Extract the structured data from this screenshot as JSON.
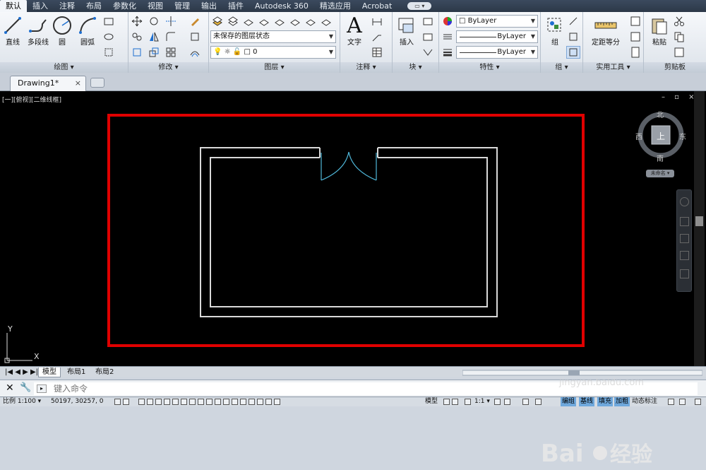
{
  "ribbon_tabs": [
    "默认",
    "插入",
    "注释",
    "布局",
    "参数化",
    "视图",
    "管理",
    "输出",
    "插件",
    "Autodesk 360",
    "精选应用",
    "Acrobat"
  ],
  "ribbon_tab_pill": "▭ ▾",
  "draw_panel": {
    "tools": [
      "直线",
      "多段线",
      "圆",
      "圆弧"
    ],
    "title": "绘图 ▾"
  },
  "modify_panel": {
    "title": "修改 ▾"
  },
  "layers_panel": {
    "layer_state": "未保存的图层状态",
    "current_layer": "0",
    "title": "图层 ▾"
  },
  "annotation_panel": {
    "text_tool": "文字",
    "title": "注释 ▾"
  },
  "block_panel": {
    "insert_tool": "插入",
    "title": "块 ▾"
  },
  "properties_panel": {
    "color": "ByLayer",
    "linetype": "ByLayer",
    "lineweight": "ByLayer",
    "title": "特性 ▾"
  },
  "groups_panel": {
    "group_tool": "组",
    "title": "组 ▾"
  },
  "utilities_panel": {
    "measure_tool": "定距等分",
    "title": "实用工具 ▾"
  },
  "clipboard_panel": {
    "paste_tool": "粘贴",
    "title": "剪贴板"
  },
  "file_tabs": {
    "active": "Drawing1*",
    "close": "×"
  },
  "viewport_label": "[一][俯视][二维线框]",
  "window_controls": "– ▫ ×",
  "viewcube": {
    "north": "北",
    "south": "南",
    "east": "东",
    "west": "西",
    "face": "上",
    "wcs_label": "未命名 ▾"
  },
  "ucs": {
    "x_label": "X",
    "y_label": "Y"
  },
  "layout_tabs": [
    "模型",
    "布局1",
    "布局2"
  ],
  "command_line": {
    "placeholder": "键入命令"
  },
  "status_bar": {
    "scale": "比例 1:100 ▾",
    "coords": "50197, 30257, 0",
    "model": "模型",
    "annoscale": "1:1 ▾",
    "toggles": [
      "编组",
      "基线",
      "填充",
      "加粗",
      "动态标注"
    ]
  },
  "watermark": {
    "text": "Baidu 经验",
    "sub": "jingyan.baidu.com"
  },
  "colors": {
    "highlight_rect": "#e00000",
    "walls": "#d9d9d9",
    "door": "#4fb7d9",
    "canvas": "#000000"
  }
}
